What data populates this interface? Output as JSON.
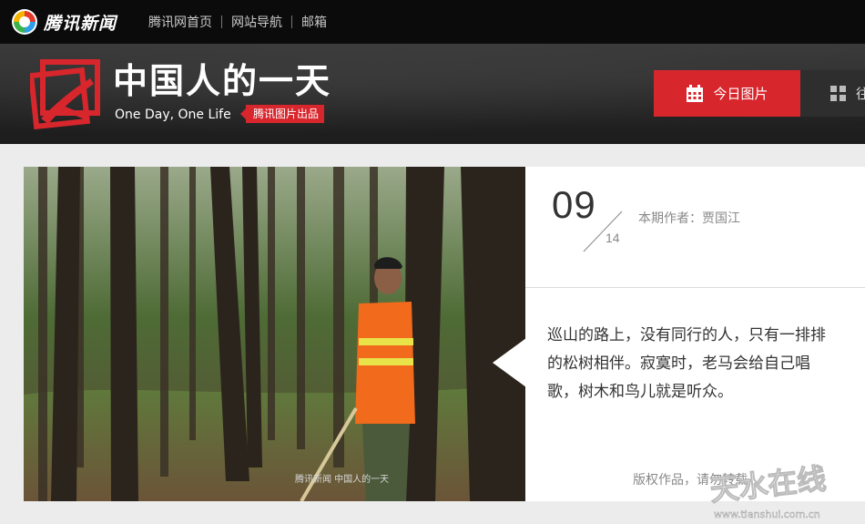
{
  "topbar": {
    "brand": "腾讯新闻",
    "nav": [
      "腾讯网首页",
      "网站导航",
      "邮箱"
    ]
  },
  "banner": {
    "title": "中国人的一天",
    "subtitle": "One Day, One Life",
    "badge": "腾讯图片出品",
    "today_button": "今日图片",
    "past_button": "往"
  },
  "article": {
    "day": "09",
    "month": "14",
    "author": "本期作者：贾国江",
    "description": "巡山的路上，没有同行的人，只有一排排的松树相伴。寂寞时，老马会给自己唱歌，树木和鸟儿就是听众。",
    "copyright": "版权作品，请勿转载",
    "photo_caption": "腾讯新闻  中国人的一天"
  },
  "watermark": {
    "text": "天水在线",
    "url": "www.tianshui.com.cn"
  },
  "colors": {
    "accent": "#d8262d",
    "topbar": "#0b0b0b"
  }
}
